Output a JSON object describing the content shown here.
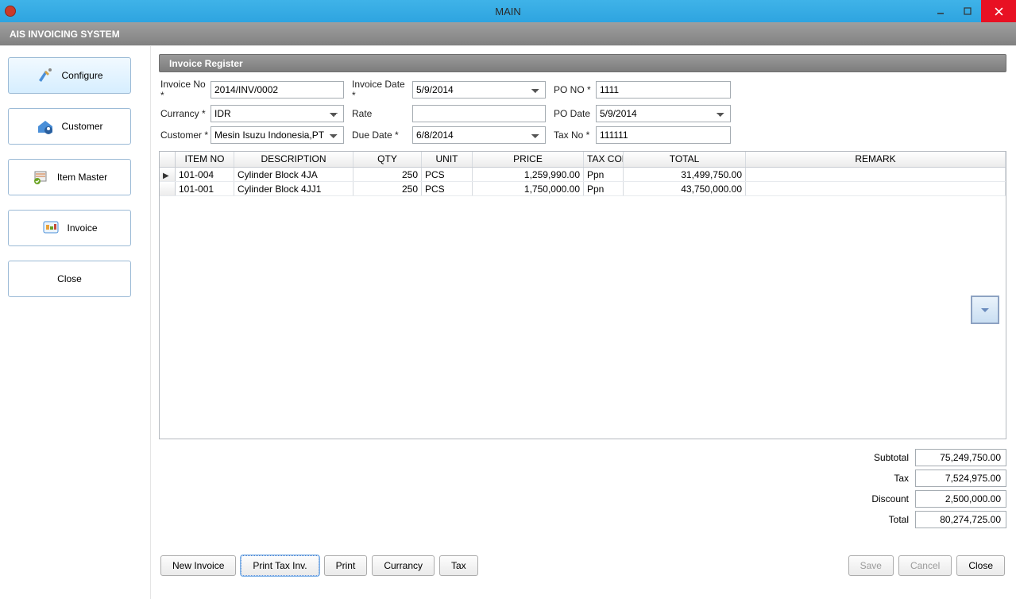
{
  "window": {
    "title": "MAIN"
  },
  "ribbon": {
    "title": "AIS INVOICING SYSTEM"
  },
  "sidebar": {
    "items": [
      {
        "label": "Configure"
      },
      {
        "label": "Customer"
      },
      {
        "label": "Item Master"
      },
      {
        "label": "Invoice"
      },
      {
        "label": "Close"
      }
    ]
  },
  "panel": {
    "title": "Invoice Register"
  },
  "form": {
    "invoice_no_label": "Invoice No *",
    "invoice_no": "2014/INV/0002",
    "invoice_date_label": "Invoice Date *",
    "invoice_date": "5/9/2014",
    "po_no_label": "PO NO *",
    "po_no": "1111",
    "currency_label": "Currancy *",
    "currency": "IDR",
    "rate_label": "Rate",
    "rate": "",
    "po_date_label": "PO Date",
    "po_date": "5/9/2014",
    "customer_label": "Customer *",
    "customer": "Mesin Isuzu Indonesia,PT",
    "due_date_label": "Due Date *",
    "due_date": "6/8/2014",
    "tax_no_label": "Tax No *",
    "tax_no": "111111"
  },
  "grid": {
    "headers": {
      "item_no": "ITEM NO",
      "description": "DESCRIPTION",
      "qty": "QTY",
      "unit": "UNIT",
      "price": "PRICE",
      "tax_code": "TAX COD",
      "total": "TOTAL",
      "remark": "REMARK"
    },
    "rows": [
      {
        "item_no": "101-004",
        "description": "Cylinder Block 4JA",
        "qty": "250",
        "unit": "PCS",
        "price": "1,259,990.00",
        "tax_code": "Ppn",
        "total": "31,499,750.00",
        "remark": ""
      },
      {
        "item_no": "101-001",
        "description": "Cylinder Block 4JJ1",
        "qty": "250",
        "unit": "PCS",
        "price": "1,750,000.00",
        "tax_code": "Ppn",
        "total": "43,750,000.00",
        "remark": ""
      }
    ]
  },
  "totals": {
    "subtotal_label": "Subtotal",
    "subtotal": "75,249,750.00",
    "tax_label": "Tax",
    "tax": "7,524,975.00",
    "discount_label": "Discount",
    "discount": "2,500,000.00",
    "total_label": "Total",
    "total": "80,274,725.00"
  },
  "footer": {
    "new_invoice": "New Invoice",
    "print_tax": "Print Tax Inv.",
    "print": "Print",
    "currency": "Currancy",
    "tax": "Tax",
    "save": "Save",
    "cancel": "Cancel",
    "close": "Close"
  }
}
